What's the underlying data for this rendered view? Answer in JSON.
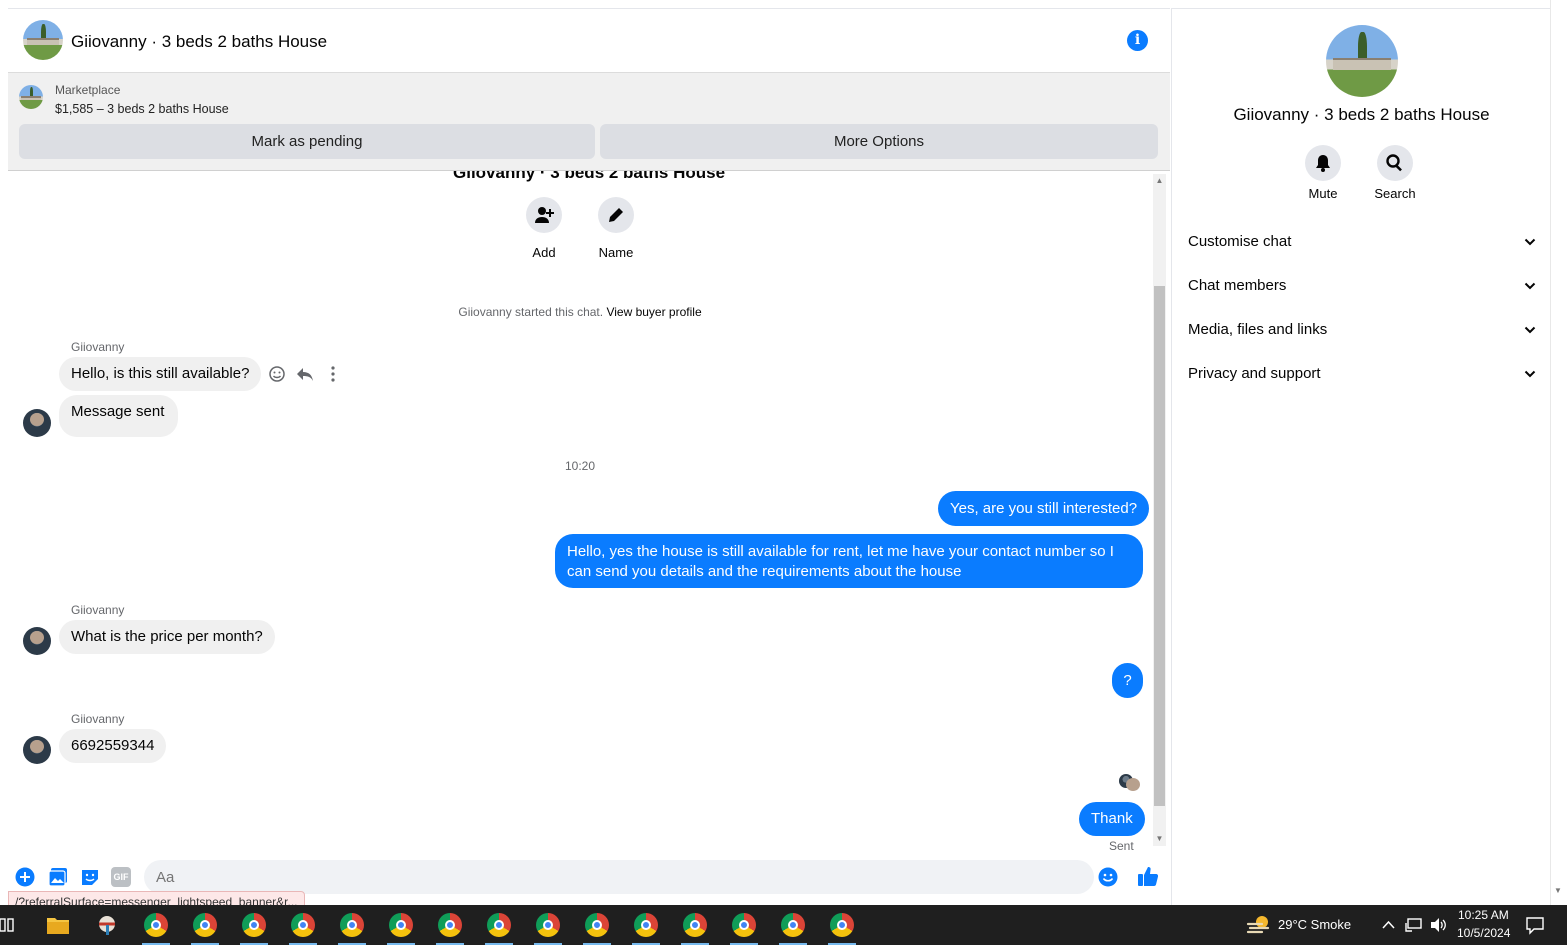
{
  "header": {
    "title": "Giiovanny · 3 beds 2 baths House"
  },
  "banner": {
    "source_label": "Marketplace",
    "listing": "$1,585 – 3 beds 2 baths House",
    "pending_button": "Mark as pending",
    "options_button": "More Options"
  },
  "intro": {
    "cut_title": "Giiovanny · 3 beds 2 baths House",
    "add_label": "Add",
    "name_label": "Name",
    "started_text": "Giiovanny started this chat.",
    "buyer_profile_link": "View buyer profile"
  },
  "messages": {
    "sender_name": "Giiovanny",
    "m1": "Hello, is this still available?",
    "m2": "Message sent",
    "time": "10:20",
    "m3": "Yes, are you still interested?",
    "m4_line1": "Hello, yes the house is still available for rent, let me have your contact number so I",
    "m4_line2": "can send you details and the requirements about the house",
    "m5": "What is the price per month?",
    "m6": "?",
    "m7": "6692559344",
    "m8": "Thank",
    "sent_status": "Sent"
  },
  "composer": {
    "placeholder": "Aa",
    "gif_label": "GIF"
  },
  "status_bar": {
    "url": "/?referralSurface=messenger_lightspeed_banner&r..."
  },
  "right_panel": {
    "title": "Giiovanny · 3 beds 2 baths House",
    "mute_label": "Mute",
    "search_label": "Search",
    "rows": [
      {
        "label": "Customise chat"
      },
      {
        "label": "Chat members"
      },
      {
        "label": "Media, files and links"
      },
      {
        "label": "Privacy and support"
      }
    ]
  },
  "taskbar": {
    "weather": "29°C  Smoke",
    "time": "10:25 AM",
    "date": "10/5/2024"
  },
  "colors": {
    "accent": "#0a7cff",
    "bubble_in": "#f0f0f0",
    "taskbar": "#1f1f1f"
  }
}
